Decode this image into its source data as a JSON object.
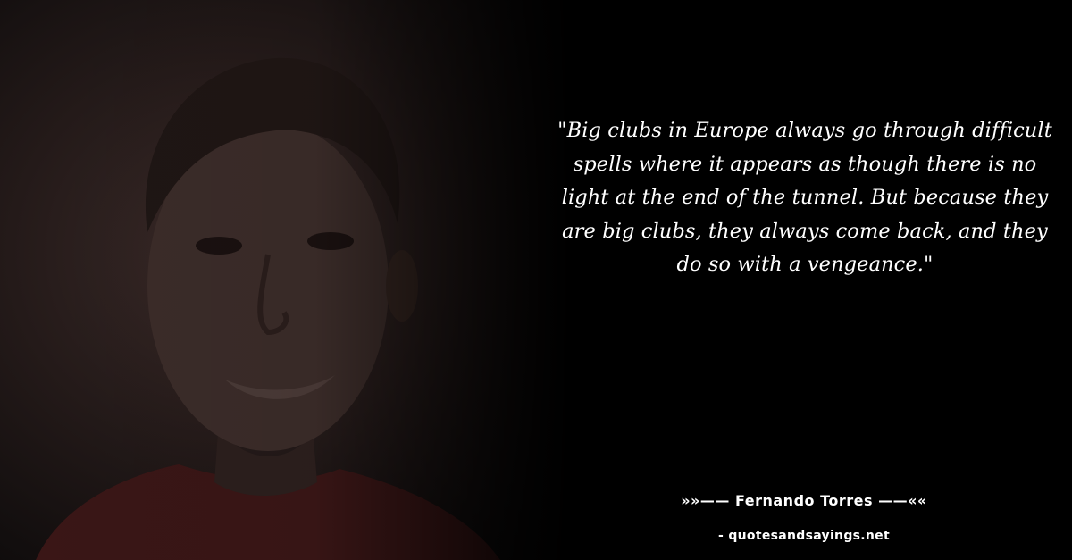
{
  "quote": {
    "text": "\"Big clubs in Europe always go through difficult spells where it appears as though there is no light at the end of the tunnel. But because they are big clubs, they always come back, and they do so with a vengeance.\""
  },
  "author": {
    "line": "»»—— Fernando Torres ——««"
  },
  "source": {
    "line": "- quotesandsayings.net"
  },
  "photo": {
    "subject": "portrait-photo"
  },
  "colors": {
    "background": "#000000",
    "text": "#ffffff"
  }
}
